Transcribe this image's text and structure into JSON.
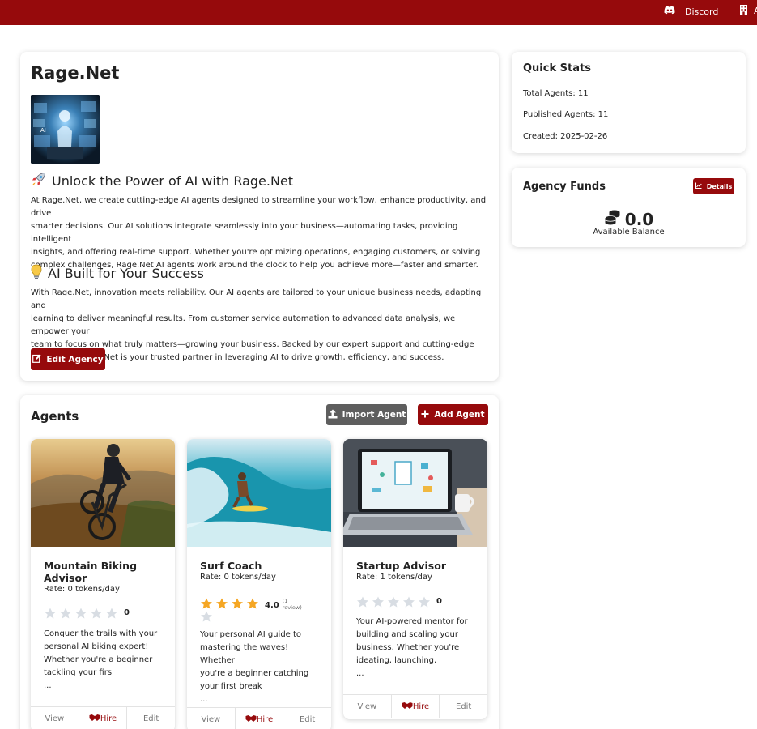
{
  "topbar": {
    "discord_label": "Discord",
    "second_label": "A"
  },
  "agency": {
    "title": "Rage.Net",
    "section1_icon": "rocket-icon",
    "section1_title": "Unlock the Power of AI with Rage.Net",
    "section1_lines": [
      "At Rage.Net, we create cutting-edge AI agents designed to streamline your workflow, enhance productivity, and drive",
      "smarter decisions. Our AI solutions integrate seamlessly into your business—automating tasks, providing intelligent",
      "insights, and offering real-time support. Whether you're optimizing operations, engaging customers, or solving",
      "complex challenges, Rage.Net AI agents work around the clock to help you achieve more—faster and smarter."
    ],
    "section2_icon": "lightbulb-icon",
    "section2_title": "AI Built for Your Success",
    "section2_lines": [
      "With Rage.Net, innovation meets reliability. Our AI agents are tailored to your unique business needs, adapting and",
      "learning to deliver meaningful results. From customer service automation to advanced data analysis, we empower your",
      "team to focus on what truly matters—growing your business. Backed by our expert support and cutting-edge",
      "technology, Rage.Net is your trusted partner in leveraging AI to drive growth, efficiency, and success."
    ],
    "edit_button": "Edit Agency"
  },
  "quick_stats": {
    "title": "Quick Stats",
    "total_agents": "Total Agents: 11",
    "published_agents": "Published Agents: 11",
    "created": "Created: 2025-02-26"
  },
  "funds": {
    "title": "Agency Funds",
    "details_button": "Details",
    "amount": "0.0",
    "caption": "Available Balance"
  },
  "agents_section": {
    "title": "Agents",
    "import_button": "Import Agent",
    "add_button": "Add Agent",
    "agents": [
      {
        "name_lines": [
          "Mountain Biking",
          "Advisor"
        ],
        "rate": "Rate: 0 tokens/day",
        "rating": 0,
        "rating_text": "0",
        "review_text": "",
        "desc_lines": [
          "Conquer the trails with your",
          "personal AI biking expert!",
          "Whether you're a beginner",
          "tackling your firs",
          "..."
        ],
        "actions": [
          "View",
          "Hire",
          "Edit"
        ]
      },
      {
        "name_lines": [
          "Surf Coach"
        ],
        "rate": "Rate: 0 tokens/day",
        "rating": 4,
        "rating_text": "4.0",
        "review_text": "(1 review)",
        "desc_lines": [
          "Your personal AI guide to",
          "mastering the waves! Whether",
          "you're a beginner catching",
          "your first break",
          "..."
        ],
        "actions": [
          "View",
          "Hire",
          "Edit"
        ]
      },
      {
        "name_lines": [
          "Startup Advisor"
        ],
        "rate": "Rate: 1 tokens/day",
        "rating": 0,
        "rating_text": "0",
        "review_text": "",
        "desc_lines": [
          "Your AI-powered mentor for",
          "building and scaling your",
          "business. Whether you're",
          "ideating, launching,",
          "..."
        ],
        "actions": [
          "View",
          "Hire",
          "Edit"
        ]
      }
    ]
  },
  "colors": {
    "brand": "#960a0c",
    "star_filled": "#f5a623",
    "star_empty": "#d8dde3",
    "import_button": "#5e5e5e"
  }
}
